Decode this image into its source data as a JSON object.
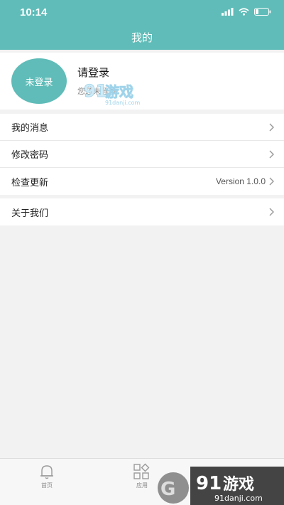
{
  "status_bar": {
    "time": "10:14"
  },
  "header": {
    "title": "我的"
  },
  "profile": {
    "avatar_label": "未登录",
    "title": "请登录",
    "subtitle": "您还未登录"
  },
  "menu": {
    "messages": "我的消息",
    "change_password": "修改密码",
    "check_update": "检查更新",
    "version": "Version 1.0.0",
    "about": "关于我们"
  },
  "tabbar": {
    "home": "首页",
    "apps": "应用"
  },
  "watermark": {
    "brand": "游戏",
    "domain": "91danji.com"
  },
  "colors": {
    "accent": "#5fbcb8"
  }
}
